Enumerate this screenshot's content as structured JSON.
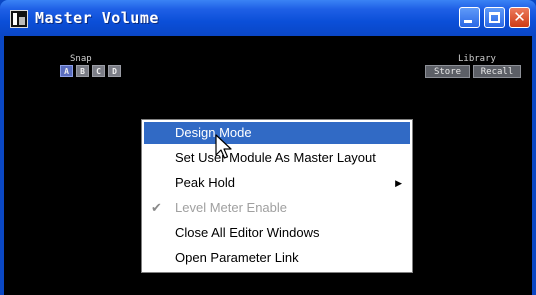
{
  "window": {
    "title": "Master Volume",
    "controls": {
      "close_glyph": "✕"
    }
  },
  "snap": {
    "label": "Snap",
    "buttons": [
      "A",
      "B",
      "C",
      "D"
    ],
    "active_index": 0
  },
  "library": {
    "label": "Library",
    "store_label": "Store",
    "recall_label": "Recall"
  },
  "context_menu": {
    "items": [
      {
        "label": "Design Mode",
        "state": "highlighted"
      },
      {
        "label": "Set User Module As Master Layout",
        "state": "normal"
      },
      {
        "label": "Peak Hold",
        "state": "normal",
        "submenu": true,
        "arrow_glyph": "▶"
      },
      {
        "label": "Level Meter Enable",
        "state": "disabled",
        "checked": true,
        "check_glyph": "✔"
      },
      {
        "label": "Close All Editor Windows",
        "state": "normal"
      },
      {
        "label": "Open Parameter Link",
        "state": "normal"
      }
    ]
  },
  "colors": {
    "titlebar": "#0b4fd8",
    "client_background": "#000000",
    "menu_highlight": "#316ac5",
    "disabled_text": "#a0a0a0"
  }
}
